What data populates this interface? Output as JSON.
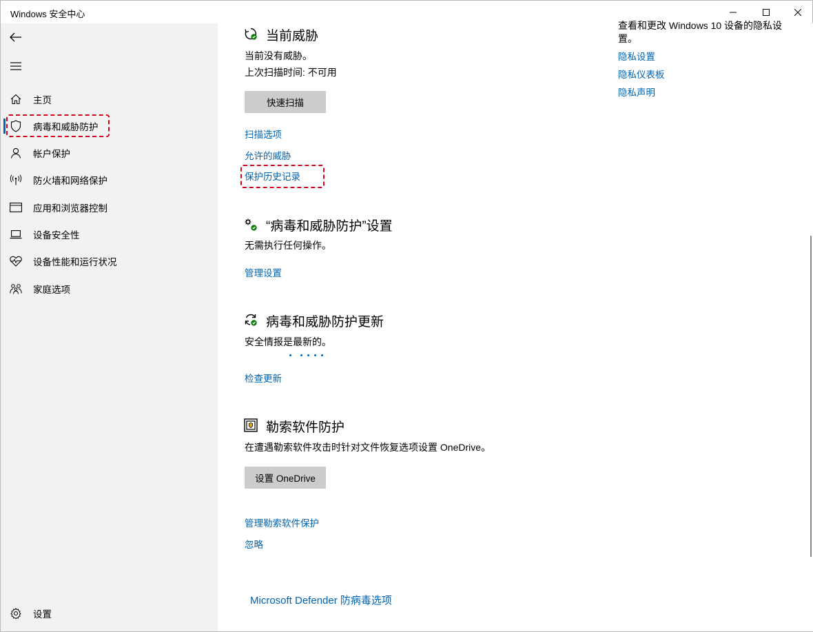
{
  "window": {
    "title": "Windows 安全中心"
  },
  "sidebar": {
    "items": [
      {
        "label": "主页",
        "icon": "home-icon"
      },
      {
        "label": "病毒和威胁防护",
        "icon": "shield-icon",
        "active": true
      },
      {
        "label": "帐户保护",
        "icon": "person-icon"
      },
      {
        "label": "防火墙和网络保护",
        "icon": "antenna-icon"
      },
      {
        "label": "应用和浏览器控制",
        "icon": "browser-window-icon"
      },
      {
        "label": "设备安全性",
        "icon": "laptop-icon"
      },
      {
        "label": "设备性能和运行状况",
        "icon": "heart-pulse-icon"
      },
      {
        "label": "家庭选项",
        "icon": "family-icon"
      }
    ],
    "settings_label": "设置"
  },
  "current_threats": {
    "title": "当前威胁",
    "status": "当前没有威胁。",
    "last_scan": "上次扫描时间: 不可用",
    "quick_scan_button": "快速扫描",
    "links": {
      "scan_options": "扫描选项",
      "allowed_threats": "允许的威胁",
      "protection_history": "保护历史记录"
    }
  },
  "protection_settings": {
    "title": "“病毒和威胁防护”设置",
    "status": "无需执行任何操作。",
    "manage_link": "管理设置"
  },
  "protection_updates": {
    "title": "病毒和威胁防护更新",
    "status": "安全情报是最新的。",
    "check_link": "检查更新"
  },
  "ransomware": {
    "title": "勒索软件防护",
    "description": "在遭遇勒索软件攻击时针对文件恢复选项设置 OneDrive。",
    "setup_button": "设置 OneDrive",
    "manage_link": "管理勒索软件保护",
    "dismiss_link": "忽略"
  },
  "defender_link": "Microsoft Defender 防病毒选项",
  "privacy": {
    "intro_text": "查看和更改 Windows 10 设备的隐私设置。",
    "links": [
      "隐私设置",
      "隐私仪表板",
      "隐私声明"
    ]
  },
  "colors": {
    "accent": "#0063b1",
    "highlight_box": "#d0021b",
    "sidebar_bg": "#f2f2f2",
    "button_bg": "#cccccc"
  }
}
